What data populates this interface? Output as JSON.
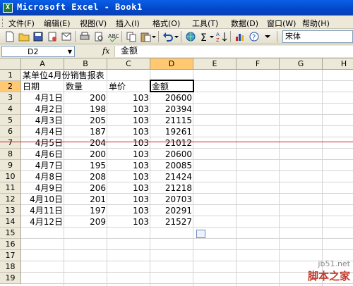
{
  "window": {
    "title": "Microsoft Excel - Book1",
    "app_icon": "X"
  },
  "menu": [
    "文件(F)",
    "编辑(E)",
    "视图(V)",
    "插入(I)",
    "格式(O)",
    "工具(T)",
    "数据(D)",
    "窗口(W)",
    "帮助(H)"
  ],
  "toolbar": {
    "font_name": "宋体"
  },
  "formula": {
    "name_box": "D2",
    "fx": "fx",
    "content": "金额"
  },
  "columns": [
    "A",
    "B",
    "C",
    "D",
    "E",
    "F",
    "G",
    "H"
  ],
  "rows": [
    "1",
    "2",
    "3",
    "4",
    "5",
    "6",
    "7",
    "8",
    "9",
    "10",
    "11",
    "12",
    "13",
    "14",
    "15",
    "16",
    "17",
    "18",
    "19"
  ],
  "sheet": {
    "title": "某单位4月份销售报表",
    "headers": [
      "日期",
      "数量",
      "单价",
      "金额"
    ],
    "data": [
      [
        "4月1日",
        "200",
        "103",
        "20600"
      ],
      [
        "4月2日",
        "198",
        "103",
        "20394"
      ],
      [
        "4月3日",
        "205",
        "103",
        "21115"
      ],
      [
        "4月4日",
        "187",
        "103",
        "19261"
      ],
      [
        "4月5日",
        "204",
        "103",
        "21012"
      ],
      [
        "4月6日",
        "200",
        "103",
        "20600"
      ],
      [
        "4月7日",
        "195",
        "103",
        "20085"
      ],
      [
        "4月8日",
        "208",
        "103",
        "21424"
      ],
      [
        "4月9日",
        "206",
        "103",
        "21218"
      ],
      [
        "4月10日",
        "201",
        "103",
        "20703"
      ],
      [
        "4月11日",
        "197",
        "103",
        "20291"
      ],
      [
        "4月12日",
        "209",
        "103",
        "21527"
      ]
    ]
  },
  "watermark": {
    "line1": "jb51.net",
    "line2": "脚本之家"
  },
  "colors": {
    "title_bar": "#0348c8",
    "header_bg": "#ece9d8",
    "selected_header": "#ffc871",
    "red_line": "#d01818"
  }
}
